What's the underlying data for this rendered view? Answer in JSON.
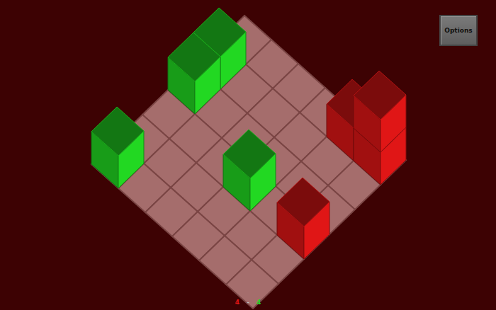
{
  "options_button": {
    "label": "Options"
  },
  "board": {
    "rows": 6,
    "cols": 6
  },
  "pieces": [
    {
      "team": "green",
      "row": 1,
      "col": 0,
      "height": 1,
      "color": "#22d822"
    },
    {
      "team": "green",
      "row": 2,
      "col": 0,
      "height": 1,
      "color": "#22d822"
    },
    {
      "team": "green",
      "row": 5,
      "col": 0,
      "height": 1,
      "color": "#22d822"
    },
    {
      "team": "green",
      "row": 3,
      "col": 3,
      "height": 1,
      "color": "#22d822"
    },
    {
      "team": "red",
      "row": 0,
      "col": 4,
      "height": 1,
      "color": "#e01616"
    },
    {
      "team": "red",
      "row": 0,
      "col": 5,
      "height": 2,
      "color": "#e01616"
    },
    {
      "team": "red",
      "row": 3,
      "col": 5,
      "height": 1,
      "color": "#e01616"
    }
  ],
  "score": [
    {
      "text": "4",
      "color": "#e01616"
    },
    {
      "text": "-",
      "color": "#bdbdbd"
    },
    {
      "text": "4",
      "color": "#22d822"
    }
  ]
}
